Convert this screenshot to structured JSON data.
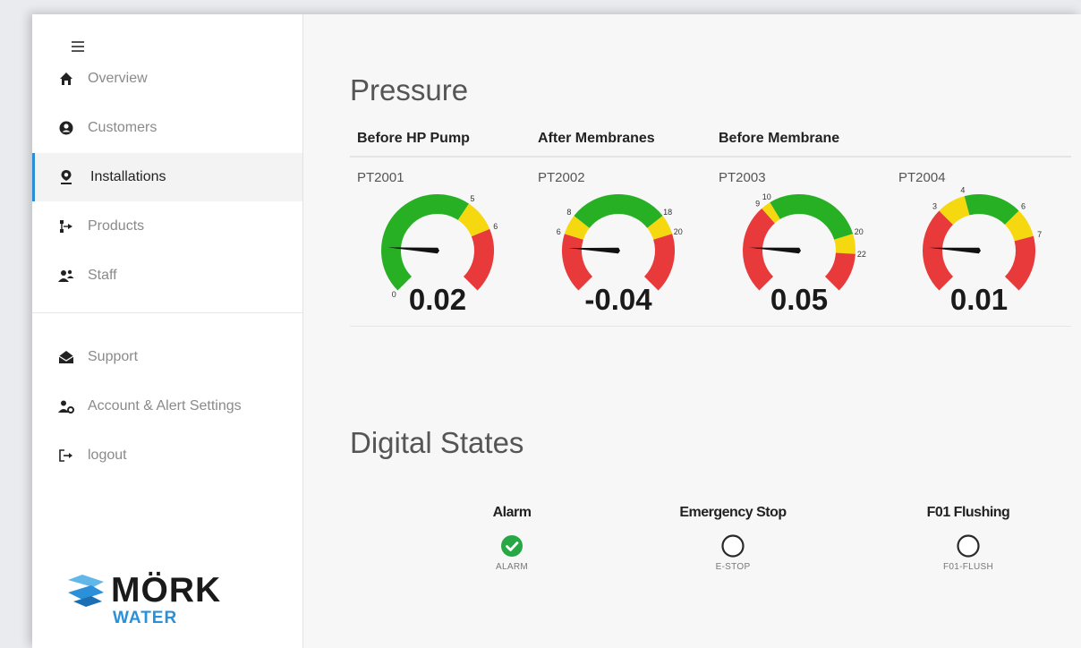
{
  "sidebar": {
    "items": [
      {
        "label": "Overview",
        "icon": "home-icon"
      },
      {
        "label": "Customers",
        "icon": "user-circle-icon"
      },
      {
        "label": "Installations",
        "icon": "map-pin-icon",
        "active": true
      },
      {
        "label": "Products",
        "icon": "sitemap-icon"
      },
      {
        "label": "Staff",
        "icon": "users-icon"
      }
    ],
    "secondary": [
      {
        "label": "Support",
        "icon": "envelope-open-icon"
      },
      {
        "label": "Account & Alert Settings",
        "icon": "user-settings-icon"
      },
      {
        "label": "logout",
        "icon": "sign-out-icon"
      }
    ],
    "logo": {
      "line1": "MÖRK",
      "line2": "WATER"
    }
  },
  "pressure": {
    "title": "Pressure",
    "columns": [
      "Before HP Pump",
      "After Membranes",
      "Before Membrane"
    ],
    "gauges": [
      {
        "tag": "PT2001",
        "value": "0.02",
        "reading": 0.02,
        "min": 0,
        "max": 8,
        "low_label": "0",
        "labels": [
          "5",
          "6"
        ],
        "zones": [
          [
            "green",
            0,
            5
          ],
          [
            "yellow",
            5,
            6
          ],
          [
            "red",
            6,
            8
          ]
        ]
      },
      {
        "tag": "PT2002",
        "value": "-0.04",
        "reading": -0.04,
        "min": 0,
        "max": 26,
        "labels": [
          "6",
          "8",
          "18",
          "20"
        ],
        "zones": [
          [
            "red",
            0,
            6
          ],
          [
            "yellow",
            6,
            8
          ],
          [
            "green",
            8,
            18
          ],
          [
            "yellow",
            18,
            20
          ],
          [
            "red",
            20,
            26
          ]
        ]
      },
      {
        "tag": "PT2003",
        "value": "0.05",
        "reading": 0.05,
        "min": 0,
        "max": 26,
        "labels": [
          "9",
          "10",
          "20",
          "22"
        ],
        "zones": [
          [
            "red",
            0,
            9
          ],
          [
            "yellow",
            9,
            10
          ],
          [
            "green",
            10,
            20
          ],
          [
            "yellow",
            20,
            22
          ],
          [
            "red",
            22,
            26
          ]
        ]
      },
      {
        "tag": "PT2004",
        "value": "0.01",
        "reading": 0.01,
        "min": 0,
        "max": 9,
        "labels": [
          "3",
          "4",
          "6",
          "7"
        ],
        "zones": [
          [
            "red",
            0,
            3
          ],
          [
            "yellow",
            3,
            4
          ],
          [
            "green",
            4,
            6
          ],
          [
            "yellow",
            6,
            7
          ],
          [
            "red",
            7,
            9
          ]
        ]
      }
    ],
    "zone_colors": {
      "green": "#27b024",
      "yellow": "#f5d810",
      "red": "#e8393b"
    }
  },
  "digital": {
    "title": "Digital States",
    "items": [
      {
        "label": "Alarm",
        "code": "ALARM",
        "active": true
      },
      {
        "label": "Emergency Stop",
        "code": "E-STOP",
        "active": false
      },
      {
        "label": "F01 Flushing",
        "code": "F01-FLUSH",
        "active": false
      }
    ]
  },
  "colors": {
    "accent": "#2b8fd8",
    "ok": "#27a844"
  }
}
